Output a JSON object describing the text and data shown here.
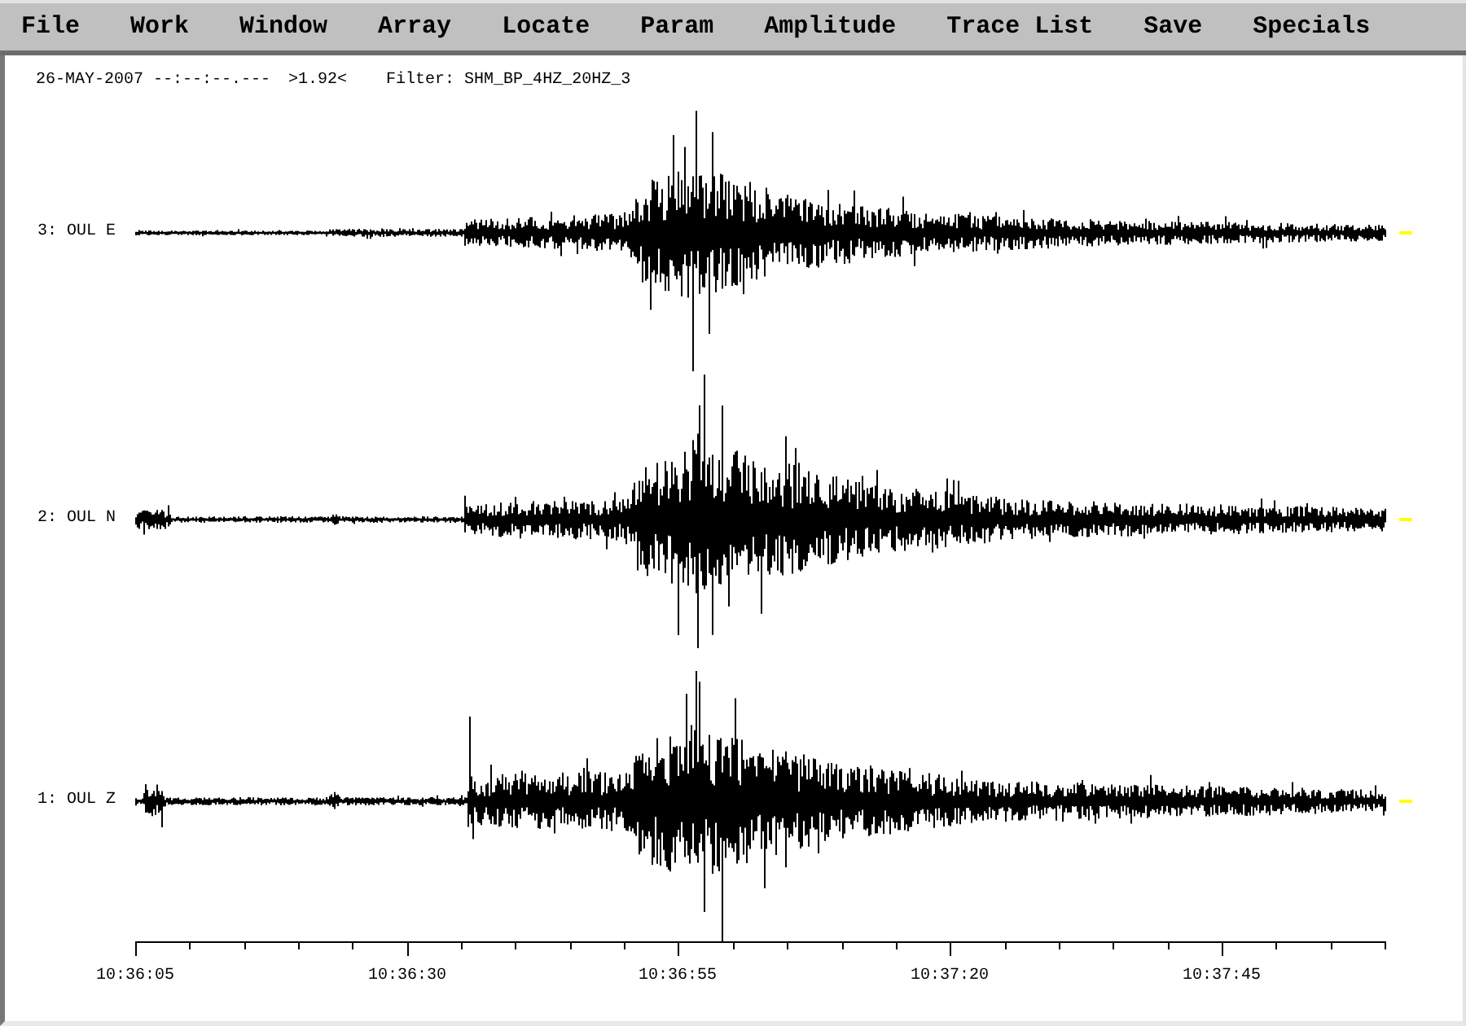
{
  "menu": [
    "File",
    "Work",
    "Window",
    "Array",
    "Locate",
    "Param",
    "Amplitude",
    "Trace List",
    "Save",
    "Specials"
  ],
  "header": {
    "date_time": "26-MAY-2007 --:--:--.---",
    "scale": ">1.92<",
    "filter": "Filter: SHM_BP_4HZ_20HZ_3"
  },
  "traces": [
    {
      "label": "3: OUL E"
    },
    {
      "label": "2: OUL N"
    },
    {
      "label": "1: OUL Z"
    }
  ],
  "time_axis": {
    "labels": [
      "10:36:05",
      "10:36:30",
      "10:36:55",
      "10:37:20",
      "10:37:45"
    ]
  }
}
